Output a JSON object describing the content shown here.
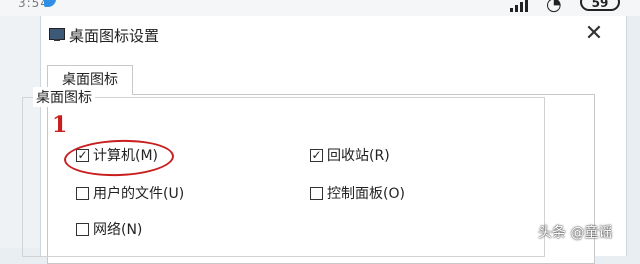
{
  "status_bar": {
    "time": "3:54",
    "battery": "59"
  },
  "dialog": {
    "title": "桌面图标设置",
    "close_glyph": "✕",
    "tab_label": "桌面图标",
    "group_label": "桌面图标",
    "checkboxes": [
      {
        "label": "计算机(M)",
        "checked": true
      },
      {
        "label": "回收站(R)",
        "checked": true
      },
      {
        "label": "用户的文件(U)",
        "checked": false
      },
      {
        "label": "控制面板(O)",
        "checked": false
      },
      {
        "label": "网络(N)",
        "checked": false
      }
    ]
  },
  "annotation": {
    "number": "1",
    "color": "#c81e1e"
  },
  "watermark": "头条 @童谣"
}
